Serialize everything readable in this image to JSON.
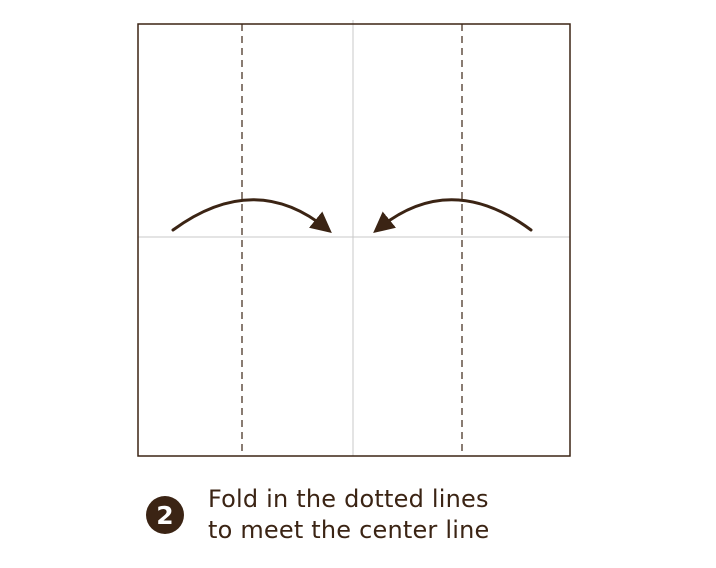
{
  "step": {
    "number": "2",
    "lines": [
      "Fold in the dotted lines",
      "to meet the center line"
    ]
  },
  "colors": {
    "outline": "#3b2414",
    "arrow": "#3b2414",
    "fold_line": "#3b2414",
    "crease": "#c8c8c8",
    "badge": "#3b2414",
    "text": "#3b2414"
  },
  "icons": {
    "left_arrow": "curved-arrow-right-icon",
    "right_arrow": "curved-arrow-left-icon"
  }
}
